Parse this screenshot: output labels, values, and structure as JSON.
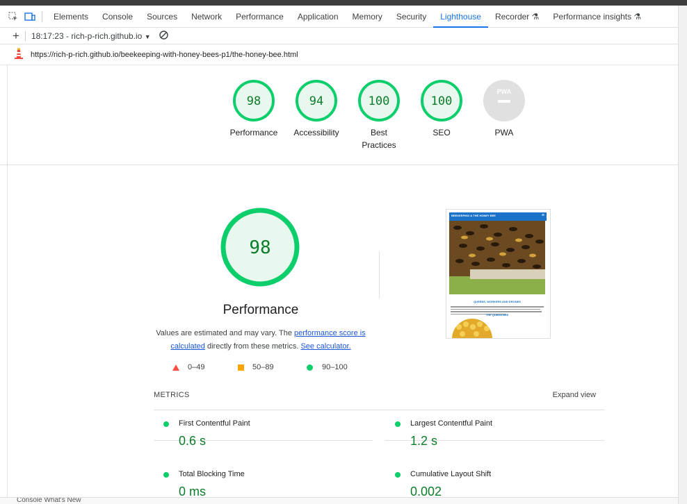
{
  "devtools": {
    "tabs": [
      "Elements",
      "Console",
      "Sources",
      "Network",
      "Performance",
      "Application",
      "Memory",
      "Security",
      "Lighthouse",
      "Recorder",
      "Performance insights"
    ],
    "active_tab": "Lighthouse",
    "report_selector": "18:17:23 - rich-p-rich.github.io",
    "url": "https://rich-p-rich.github.io/beekeeping-with-honey-bees-p1/the-honey-bee.html",
    "bottom_text": "Console   What's New"
  },
  "gauges": [
    {
      "label": "Performance",
      "score": "98",
      "fraction": 0.98
    },
    {
      "label": "Accessibility",
      "score": "94",
      "fraction": 0.94
    },
    {
      "label": "Best Practices",
      "score": "100",
      "fraction": 1.0
    },
    {
      "label": "SEO",
      "score": "100",
      "fraction": 1.0
    },
    {
      "label": "PWA",
      "score": "",
      "badge": "PWA"
    }
  ],
  "performance": {
    "score": "98",
    "title": "Performance",
    "desc_prefix": "Values are estimated and may vary. The ",
    "desc_link1": "performance score is calculated",
    "desc_mid": " directly from these metrics. ",
    "desc_link2": "See calculator.",
    "legend": [
      {
        "range": "0–49",
        "color": "#ff4e42"
      },
      {
        "range": "50–89",
        "color": "#ffa400"
      },
      {
        "range": "90–100",
        "color": "#0cce6b"
      }
    ]
  },
  "thumbnail": {
    "header": "BEEKEEPING & THE HONEY BEE",
    "heading": "QUEENS, WORKERS AND DRONES",
    "subheading": "THE QUEEN BEE"
  },
  "metrics": {
    "heading": "METRICS",
    "expand": "Expand view",
    "items": [
      {
        "name": "First Contentful Paint",
        "value": "0.6 s"
      },
      {
        "name": "Largest Contentful Paint",
        "value": "1.2 s"
      },
      {
        "name": "Total Blocking Time",
        "value": "0 ms"
      },
      {
        "name": "Cumulative Layout Shift",
        "value": "0.002"
      }
    ]
  },
  "colors": {
    "pass": "#0cce6b",
    "pass_text": "#0c7d2a",
    "pass_fill": "#e8f8ee",
    "accent": "#1a73e8"
  }
}
